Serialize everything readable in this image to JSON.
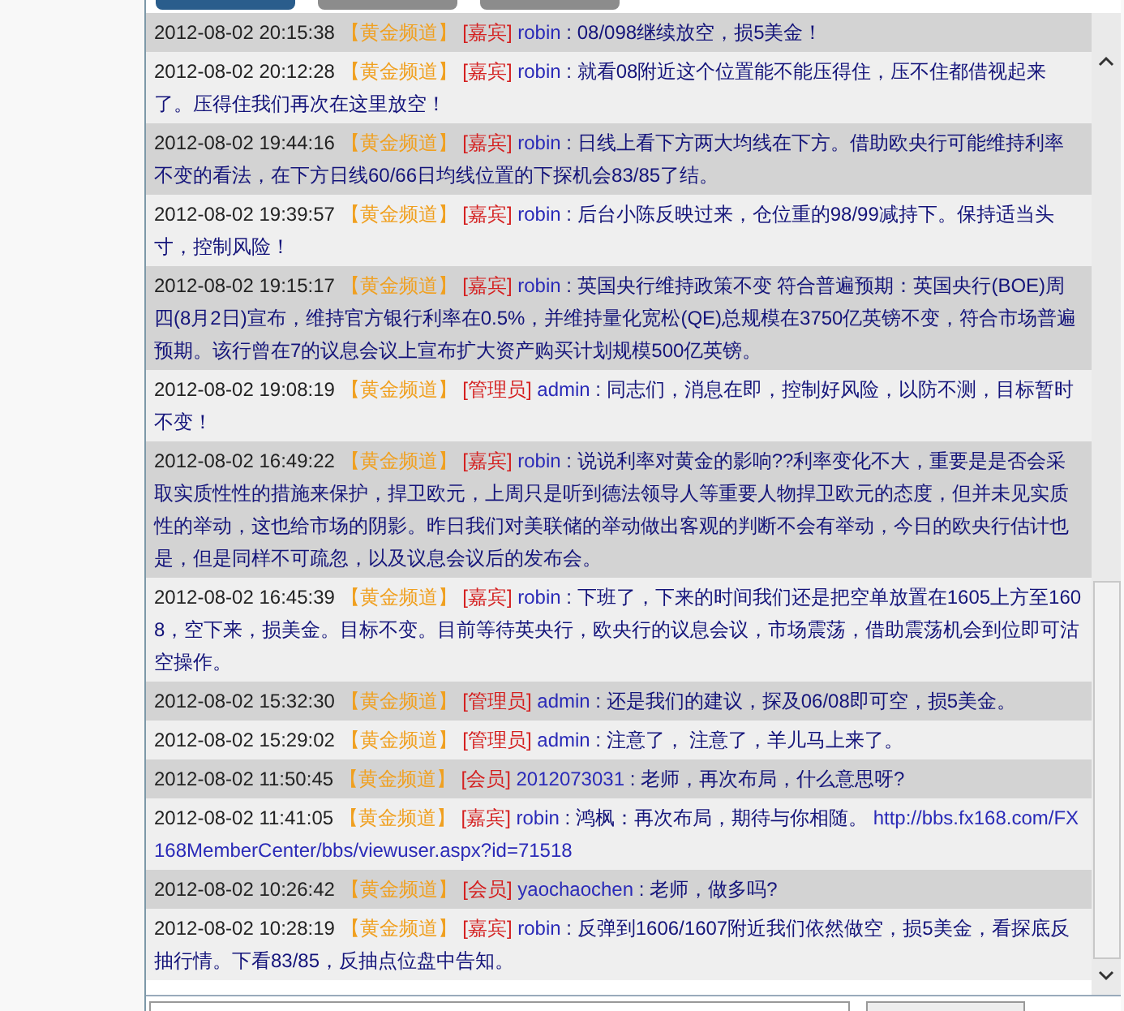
{
  "tabs": [
    {
      "selected": true
    },
    {
      "selected": false
    },
    {
      "selected": false
    }
  ],
  "messages": [
    {
      "time": "2012-08-02 20:15:38",
      "channel": "【黄金频道】",
      "role": "[嘉宾]",
      "user": "robin",
      "separator": ":",
      "text": "08/098继续放空，损5美金！"
    },
    {
      "time": "2012-08-02 20:12:28",
      "channel": "【黄金频道】",
      "role": "[嘉宾]",
      "user": "robin",
      "separator": ":",
      "text": "就看08附近这个位置能不能压得住，压不住都借视起来了。压得住我们再次在这里放空！"
    },
    {
      "time": "2012-08-02 19:44:16",
      "channel": "【黄金频道】",
      "role": "[嘉宾]",
      "user": "robin",
      "separator": ":",
      "text": "日线上看下方两大均线在下方。借助欧央行可能维持利率不变的看法，在下方日线60/66日均线位置的下探机会83/85了结。"
    },
    {
      "time": "2012-08-02 19:39:57",
      "channel": "【黄金频道】",
      "role": "[嘉宾]",
      "user": "robin",
      "separator": ":",
      "text": "后台小陈反映过来，仓位重的98/99减持下。保持适当头寸，控制风险！"
    },
    {
      "time": "2012-08-02 19:15:17",
      "channel": "【黄金频道】",
      "role": "[嘉宾]",
      "user": "robin",
      "separator": ":",
      "text": "英国央行维持政策不变 符合普遍预期：英国央行(BOE)周四(8月2日)宣布，维持官方银行利率在0.5%，并维持量化宽松(QE)总规模在3750亿英镑不变，符合市场普遍预期。该行曾在7的议息会议上宣布扩大资产购买计划规模500亿英镑。"
    },
    {
      "time": "2012-08-02 19:08:19",
      "channel": "【黄金频道】",
      "role": "[管理员]",
      "user": "admin",
      "separator": ":",
      "text": "同志们，消息在即，控制好风险，以防不测，目标暂时不变！"
    },
    {
      "time": "2012-08-02 16:49:22",
      "channel": "【黄金频道】",
      "role": "[嘉宾]",
      "user": "robin",
      "separator": ":",
      "text": "说说利率对黄金的影响??利率变化不大，重要是是否会采取实质性性的措施来保护，捍卫欧元，上周只是听到德法领导人等重要人物捍卫欧元的态度，但并未见实质性的举动，这也给市场的阴影。昨日我们对美联储的举动做出客观的判断不会有举动，今日的欧央行估计也是，但是同样不可疏忽，以及议息会议后的发布会。"
    },
    {
      "time": "2012-08-02 16:45:39",
      "channel": "【黄金频道】",
      "role": "[嘉宾]",
      "user": "robin",
      "separator": ":",
      "text": "下班了，下来的时间我们还是把空单放置在1605上方至1608，空下来，损美金。目标不变。目前等待英央行，欧央行的议息会议，市场震荡，借助震荡机会到位即可沽空操作。"
    },
    {
      "time": "2012-08-02 15:32:30",
      "channel": "【黄金频道】",
      "role": "[管理员]",
      "user": "admin",
      "separator": ":",
      "text": "还是我们的建议，探及06/08即可空，损5美金。"
    },
    {
      "time": "2012-08-02 15:29:02",
      "channel": "【黄金频道】",
      "role": "[管理员]",
      "user": "admin",
      "separator": ":",
      "text": "注意了， 注意了，羊儿马上来了。"
    },
    {
      "time": "2012-08-02 11:50:45",
      "channel": "【黄金频道】",
      "role": "[会员]",
      "user": "2012073031",
      "separator": ":",
      "text": "老师，再次布局，什么意思呀?"
    },
    {
      "time": "2012-08-02 11:41:05",
      "channel": "【黄金频道】",
      "role": "[嘉宾]",
      "user": "robin",
      "separator": ":",
      "text": "鸿枫：再次布局，期待与你相随。",
      "link": "http://bbs.fx168.com/FX168MemberCenter/bbs/viewuser.aspx?id=71518"
    },
    {
      "time": "2012-08-02 10:26:42",
      "channel": "【黄金频道】",
      "role": "[会员]",
      "user": "yaochaochen",
      "separator": ":",
      "text": "老师，做多吗?"
    },
    {
      "time": "2012-08-02 10:28:19",
      "channel": "【黄金频道】",
      "role": "[嘉宾]",
      "user": "robin",
      "separator": ":",
      "text": "反弹到1606/1607附近我们依然做空，损5美金，看探底反抽行情。下看83/85，反抽点位盘中告知。"
    }
  ]
}
